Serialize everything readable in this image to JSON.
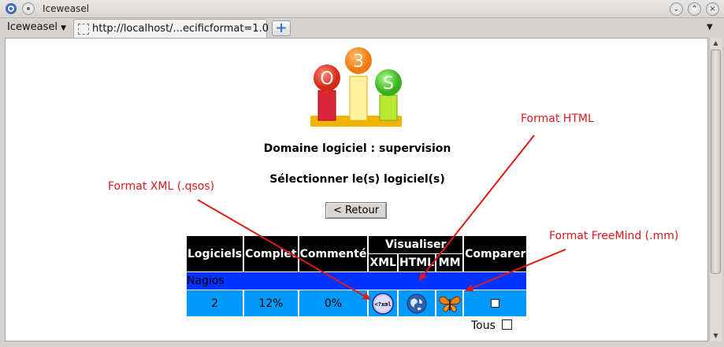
{
  "window": {
    "title": "Iceweasel"
  },
  "tabbar": {
    "menu_label": "Iceweasel",
    "tab_title": "http://localhost/...ecificformat=1.0"
  },
  "page": {
    "domain_heading": "Domaine logiciel : supervision",
    "select_heading": "Sélectionner le(s) logiciel(s)",
    "back_button": "< Retour",
    "table": {
      "headers": {
        "logiciels": "Logiciels",
        "complet": "Complet",
        "commente": "Commenté",
        "visualiser": "Visualiser",
        "xml": "XML",
        "html": "HTML",
        "mm": "MM",
        "comparer": "Comparer"
      },
      "domain_row": "Nagios",
      "row": {
        "logiciels": "2",
        "complet": "12%",
        "commente": "0%"
      }
    },
    "tous_label": "Tous"
  },
  "annotations": {
    "xml": "Format XML (.qsos)",
    "html": "Format HTML",
    "freemind": "Format FreeMind (.mm)"
  },
  "logo": {
    "letters": [
      "O",
      "3",
      "S"
    ]
  },
  "icons": {
    "xml": "xml-file-icon",
    "html": "globe-icon",
    "mm": "butterfly-icon"
  },
  "colors": {
    "header_bg": "#000000",
    "domain_row_bg": "#0033ff",
    "data_row_bg": "#0099ff",
    "annotation": "#e01818"
  }
}
